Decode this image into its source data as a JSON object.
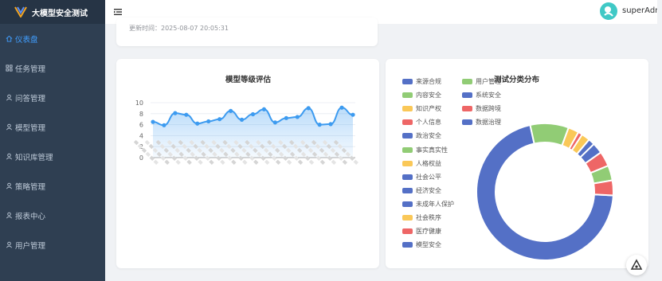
{
  "app": {
    "title": "大模型安全测试"
  },
  "sidebar": {
    "items": [
      {
        "label": "仪表盘",
        "icon": "home-icon",
        "active": true
      },
      {
        "label": "任务管理",
        "icon": "grid-icon",
        "active": false
      },
      {
        "label": "问答管理",
        "icon": "user-icon",
        "active": false
      },
      {
        "label": "模型管理",
        "icon": "user-icon",
        "active": false
      },
      {
        "label": "知识库管理",
        "icon": "user-icon",
        "active": false
      },
      {
        "label": "策略管理",
        "icon": "user-icon",
        "active": false
      },
      {
        "label": "报表中心",
        "icon": "user-icon",
        "active": false
      },
      {
        "label": "用户管理",
        "icon": "user-icon",
        "active": false
      }
    ]
  },
  "header": {
    "username": "superAdmin"
  },
  "top_card": {
    "update_time": "更新时间：2025-08-07 20:05:31"
  },
  "colors": {
    "sidebar_bg": "#2f3f52",
    "accent": "#409eff",
    "line": "#3d9bf0"
  },
  "chart_data": [
    {
      "type": "line",
      "title": "模型等级评估",
      "ylim": [
        0,
        10
      ],
      "yticks": [
        "0",
        "2",
        "4",
        "6",
        "8",
        "10"
      ],
      "series": [
        {
          "values": [
            6.5,
            5.9,
            8.1,
            7.8,
            6.2,
            6.6,
            7.0,
            8.5,
            6.9,
            7.9,
            8.8,
            6.4,
            7.2,
            7.4,
            9.0,
            6.0,
            6.1,
            9.1,
            7.8
          ]
        }
      ],
      "grid": true,
      "area": true
    },
    {
      "type": "pie",
      "title": "测试分类分布",
      "donut": true,
      "legend": [
        {
          "name": "来源合规",
          "color": "#5470c6"
        },
        {
          "name": "内容安全",
          "color": "#91cc75"
        },
        {
          "name": "知识产权",
          "color": "#fac858"
        },
        {
          "name": "个人信息",
          "color": "#ee6666"
        },
        {
          "name": "政治安全",
          "color": "#5470c6"
        },
        {
          "name": "事实真实性",
          "color": "#91cc75"
        },
        {
          "name": "人格权益",
          "color": "#fac858"
        },
        {
          "name": "社会公平",
          "color": "#5470c6"
        },
        {
          "name": "经济安全",
          "color": "#5470c6"
        },
        {
          "name": "未成年人保护",
          "color": "#5470c6"
        },
        {
          "name": "社会秩序",
          "color": "#fac858"
        },
        {
          "name": "医疗健康",
          "color": "#ee6666"
        },
        {
          "name": "模型安全",
          "color": "#5470c6"
        },
        {
          "name": "用户管理",
          "color": "#91cc75"
        },
        {
          "name": "系统安全",
          "color": "#5470c6"
        },
        {
          "name": "数据跨境",
          "color": "#ee6666"
        },
        {
          "name": "数据治理",
          "color": "#5470c6"
        }
      ],
      "slices": [
        {
          "value": 70,
          "color": "#5470c6"
        },
        {
          "value": 9,
          "color": "#91cc75"
        },
        {
          "value": 2.5,
          "color": "#fac858"
        },
        {
          "value": 1,
          "color": "#ee6666"
        },
        {
          "value": 2,
          "color": "#fac858"
        },
        {
          "value": 1.5,
          "color": "#5470c6"
        },
        {
          "value": 2.5,
          "color": "#5470c6"
        },
        {
          "value": 3.5,
          "color": "#ee6666"
        },
        {
          "value": 3.5,
          "color": "#91cc75"
        },
        {
          "value": 3.5,
          "color": "#ee6666"
        }
      ]
    }
  ]
}
